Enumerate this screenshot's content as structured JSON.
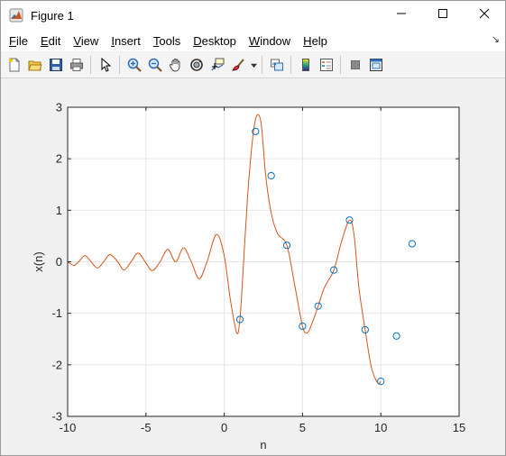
{
  "window": {
    "title": "Figure 1",
    "minimize_icon": "minimize-icon",
    "maximize_icon": "maximize-icon",
    "close_icon": "close-icon"
  },
  "menu": {
    "file": {
      "pre": "",
      "u": "F",
      "post": "ile"
    },
    "edit": {
      "pre": "",
      "u": "E",
      "post": "dit"
    },
    "view": {
      "pre": "",
      "u": "V",
      "post": "iew"
    },
    "insert": {
      "pre": "",
      "u": "I",
      "post": "nsert"
    },
    "tools": {
      "pre": "",
      "u": "T",
      "post": "ools"
    },
    "desktop": {
      "pre": "",
      "u": "D",
      "post": "esktop"
    },
    "window": {
      "pre": "",
      "u": "W",
      "post": "indow"
    },
    "help": {
      "pre": "",
      "u": "H",
      "post": "elp"
    }
  },
  "toolbar": [
    "new-figure-icon",
    "open-file-icon",
    "save-icon",
    "print-icon",
    "edit-plot-arrow-icon",
    "zoom-in-icon",
    "zoom-out-icon",
    "pan-hand-icon",
    "rotate-3d-icon",
    "data-cursor-icon",
    "brush-icon",
    "link-plot-icon",
    "insert-colorbar-icon",
    "insert-legend-icon",
    "hide-plot-tools-icon",
    "show-plot-tools-icon"
  ],
  "colors": {
    "line": "#d95319",
    "markers": "#0072bd",
    "axes_bg": "#ffffff",
    "grid": "#e6e6e6",
    "axis": "#262626"
  },
  "chart_data": {
    "type": "line",
    "title": "",
    "xlabel": "n",
    "ylabel": "x(n)",
    "xlim": [
      -10,
      15
    ],
    "ylim": [
      -3,
      3
    ],
    "xticks": [
      -10,
      -5,
      0,
      5,
      10,
      15
    ],
    "yticks": [
      -3,
      -2,
      -1,
      0,
      1,
      2,
      3
    ],
    "xtick_labels": [
      "-10",
      "-5",
      "0",
      "5",
      "10",
      "15"
    ],
    "ytick_labels": [
      "-3",
      "-2",
      "-1",
      "0",
      "1",
      "2",
      "3"
    ],
    "grid": true,
    "series": [
      {
        "style": "circle-markers",
        "x": [
          1,
          2,
          3,
          4,
          5,
          6,
          7,
          8,
          9,
          10,
          11,
          12
        ],
        "y": [
          -1.12,
          2.53,
          1.67,
          0.32,
          -1.25,
          -0.86,
          -0.16,
          0.81,
          -1.32,
          -2.32,
          -1.44,
          0.35
        ]
      },
      {
        "style": "line",
        "x": [
          -10,
          -9.6,
          -9.3,
          -8.9,
          -8.5,
          -8.1,
          -7.7,
          -7.3,
          -6.8,
          -6.4,
          -5.95,
          -5.5,
          -5.05,
          -4.6,
          -4.1,
          -3.6,
          -3.1,
          -2.6,
          -2.1,
          -1.6,
          -1.1,
          -0.5,
          0.0,
          0.4,
          0.8,
          1.0,
          1.2,
          1.5,
          1.8,
          2.05,
          2.35,
          2.65,
          3.0,
          3.4,
          4.0,
          4.5,
          5.0,
          5.3,
          5.6,
          6.0,
          6.4,
          7.0,
          7.5,
          8.0,
          8.3,
          8.6,
          9.0,
          9.4,
          9.8,
          10.0
        ],
        "y": [
          0.0,
          -0.07,
          0.0,
          0.12,
          0.0,
          -0.12,
          0.0,
          0.14,
          0.0,
          -0.16,
          0.0,
          0.17,
          0.0,
          -0.17,
          0.0,
          0.24,
          0.0,
          0.27,
          0.0,
          -0.33,
          0.0,
          0.53,
          0.12,
          -0.75,
          -1.38,
          -1.12,
          -0.2,
          1.3,
          2.35,
          2.82,
          2.7,
          1.67,
          0.95,
          0.55,
          0.32,
          -0.45,
          -1.25,
          -1.38,
          -1.2,
          -0.86,
          -0.5,
          -0.16,
          0.4,
          0.81,
          0.5,
          -0.5,
          -1.32,
          -2.05,
          -2.35,
          -2.32
        ]
      }
    ]
  }
}
